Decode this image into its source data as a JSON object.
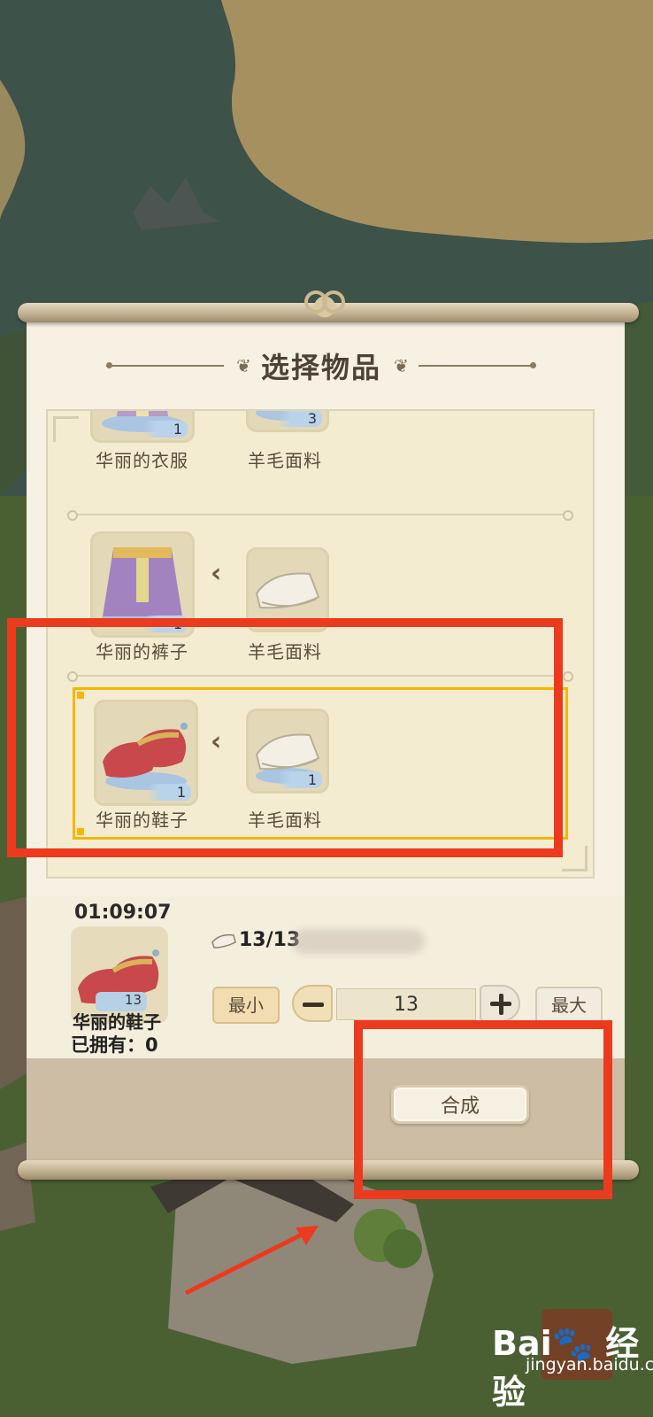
{
  "panel": {
    "title": "选择物品"
  },
  "recipes": [
    {
      "result_name": "华丽的衣服",
      "result_count": "1",
      "material_name": "羊毛面料",
      "material_count": "3"
    },
    {
      "result_name": "华丽的裤子",
      "result_count": "1",
      "material_name": "羊毛面料",
      "material_count": ""
    },
    {
      "result_name": "华丽的鞋子",
      "result_count": "1",
      "material_name": "羊毛面料",
      "material_count": "1"
    }
  ],
  "detail": {
    "timer": "01:09:07",
    "item_count": "13",
    "item_name": "华丽的鞋子",
    "owned": "已拥有：0",
    "material_progress": "13/13",
    "min_label": "最小",
    "max_label": "最大",
    "quantity": "13",
    "craft_label": "合成"
  },
  "watermark": {
    "brand": "Bai",
    "brand_cn": "经验",
    "url": "jingyan.baidu.com"
  },
  "colors": {
    "highlight": "#f7b500",
    "annotation": "#ec3a1e"
  }
}
